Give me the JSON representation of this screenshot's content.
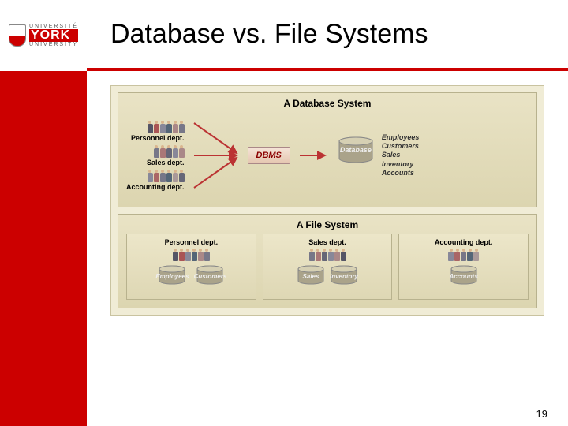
{
  "logo": {
    "universite": "UNIVERSITÉ",
    "york": "YORK",
    "university": "UNIVERSITY"
  },
  "title": "Database vs. File Systems",
  "page_number": "19",
  "db_panel": {
    "title": "A Database System",
    "departments": [
      {
        "name": "Personnel dept."
      },
      {
        "name": "Sales dept."
      },
      {
        "name": "Accounting dept."
      }
    ],
    "dbms_label": "DBMS",
    "store_label": "Database",
    "tables": [
      "Employees",
      "Customers",
      "Sales",
      "Inventory",
      "Accounts"
    ]
  },
  "file_panel": {
    "title": "A File System",
    "departments": [
      {
        "name": "Personnel dept.",
        "stores": [
          "Employees",
          "Customers"
        ]
      },
      {
        "name": "Sales dept.",
        "stores": [
          "Sales",
          "Inventory"
        ]
      },
      {
        "name": "Accounting dept.",
        "stores": [
          "Accounts"
        ]
      }
    ]
  }
}
